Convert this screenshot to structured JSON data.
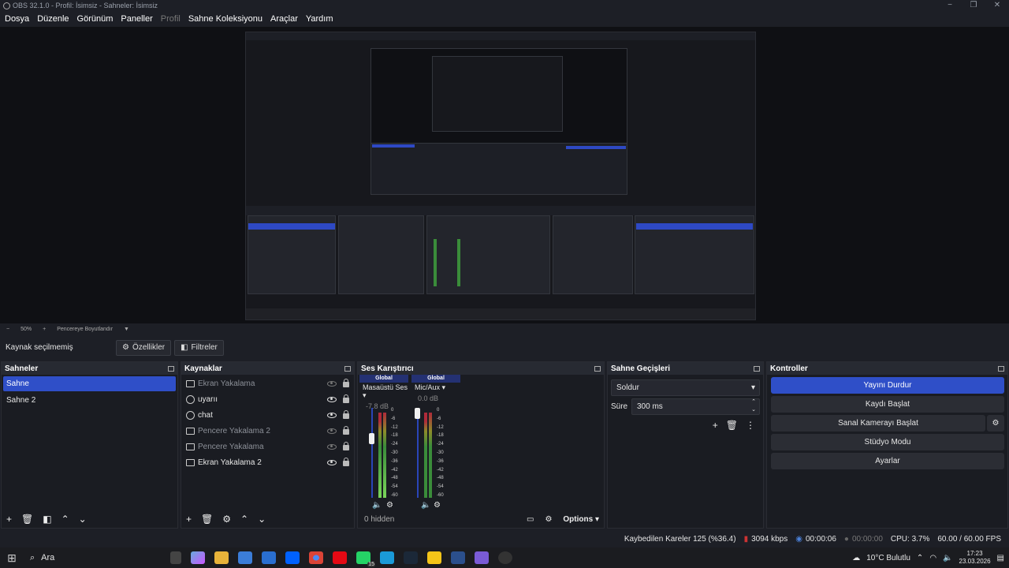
{
  "window": {
    "title": "OBS 32.1.0 - Profil: İsimsiz - Sahneler: İsimsiz"
  },
  "menu": [
    "Dosya",
    "Düzenle",
    "Görünüm",
    "Paneller",
    "Profil",
    "Sahne Koleksiyonu",
    "Araçlar",
    "Yardım"
  ],
  "zoom": {
    "minus": "−",
    "value": "50%",
    "plus": "+",
    "fit": "Pencereye Boyutlandır"
  },
  "source_bar": {
    "no_selection": "Kaynak seçilmemiş",
    "properties": "Özellikler",
    "filters": "Filtreler"
  },
  "scenes": {
    "title": "Sahneler",
    "items": [
      "Sahne",
      "Sahne 2"
    ],
    "selected": 0
  },
  "sources": {
    "title": "Kaynaklar",
    "items": [
      {
        "name": "Ekran Yakalama",
        "visible": false,
        "icon": "monitor-icon"
      },
      {
        "name": "uyarıı",
        "visible": true,
        "icon": "browser-icon"
      },
      {
        "name": "chat",
        "visible": true,
        "icon": "browser-icon"
      },
      {
        "name": "Pencere Yakalama 2",
        "visible": false,
        "icon": "window-icon"
      },
      {
        "name": "Pencere Yakalama",
        "visible": false,
        "icon": "window-icon"
      },
      {
        "name": "Ekran Yakalama 2",
        "visible": true,
        "icon": "monitor-icon"
      }
    ]
  },
  "mixer": {
    "title": "Ses Karıştırıcı",
    "channels": [
      {
        "global": "Global",
        "name": "Masaüstü Ses",
        "db": "-7.8 dB",
        "fader": 0.68
      },
      {
        "global": "Global",
        "name": "Mic/Aux",
        "db": "0.0 dB",
        "fader": 1.0
      }
    ],
    "scale": [
      "0",
      "-6",
      "-12",
      "-18",
      "-24",
      "-30",
      "-36",
      "-42",
      "-48",
      "-54",
      "-60"
    ],
    "hidden": "0 hidden",
    "options": "Options"
  },
  "transitions": {
    "title": "Sahne Geçişleri",
    "transition": "Soldur",
    "duration_label": "Süre",
    "duration": "300 ms"
  },
  "controls": {
    "title": "Kontroller",
    "buttons": [
      "Yayını Durdur",
      "Kaydı Başlat",
      "Sanal Kamerayı Başlat",
      "Stüdyo Modu",
      "Ayarlar"
    ]
  },
  "status": {
    "dropped": "Kaybedilen Kareler 125 (%36.4)",
    "bitrate": "3094 kbps",
    "stream_time": "00:00:06",
    "rec_time": "00:00:00",
    "cpu": "CPU: 3.7%",
    "fps": "60.00 / 60.00 FPS"
  },
  "taskbar": {
    "search": "Ara",
    "weather": "10°C  Bulutlu",
    "time": "17:23",
    "date": "23.03.2026",
    "badge": "15"
  },
  "colors": {
    "accent": "#2f4fc8",
    "bg": "#1d1f26",
    "meter_green": "#3a8c3a"
  }
}
